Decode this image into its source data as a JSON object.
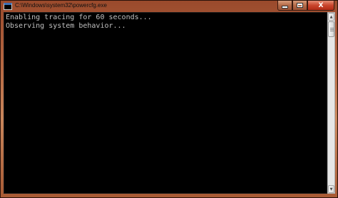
{
  "window": {
    "title": "C:\\Windows\\system32\\powercfg.exe"
  },
  "controls": {
    "close_label": "X"
  },
  "console": {
    "lines": [
      "Enabling tracing for 60 seconds...",
      "Observing system behavior..."
    ]
  },
  "icons": {
    "app": "console-app-icon",
    "minimize": "minimize-icon",
    "maximize": "maximize-icon",
    "close": "close-icon",
    "scroll_up": "scroll-up-arrow-icon",
    "scroll_down": "scroll-down-arrow-icon"
  },
  "colors": {
    "console_bg": "#000000",
    "console_text": "#c0c0c0",
    "close_button": "#c9442c"
  }
}
